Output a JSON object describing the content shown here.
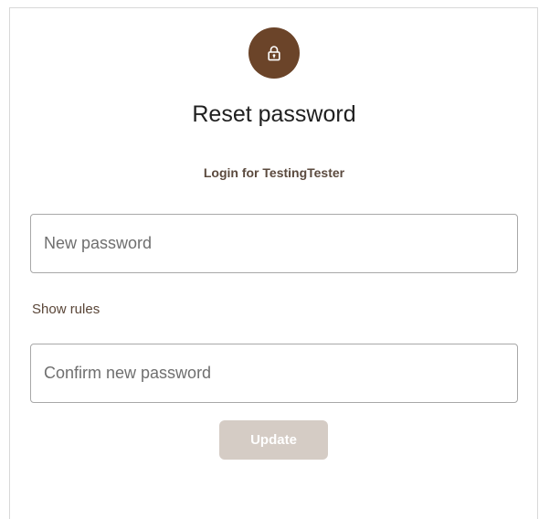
{
  "header": {
    "icon": "lock-icon",
    "title": "Reset password",
    "subtitle": "Login for TestingTester"
  },
  "form": {
    "new_password": {
      "placeholder": "New password",
      "value": ""
    },
    "show_rules_label": "Show rules",
    "confirm_password": {
      "placeholder": "Confirm new password",
      "value": ""
    },
    "update_label": "Update",
    "update_disabled": true
  },
  "colors": {
    "accent": "#6b4429",
    "button_disabled": "#d5ccc5",
    "link": "#5a4638"
  }
}
